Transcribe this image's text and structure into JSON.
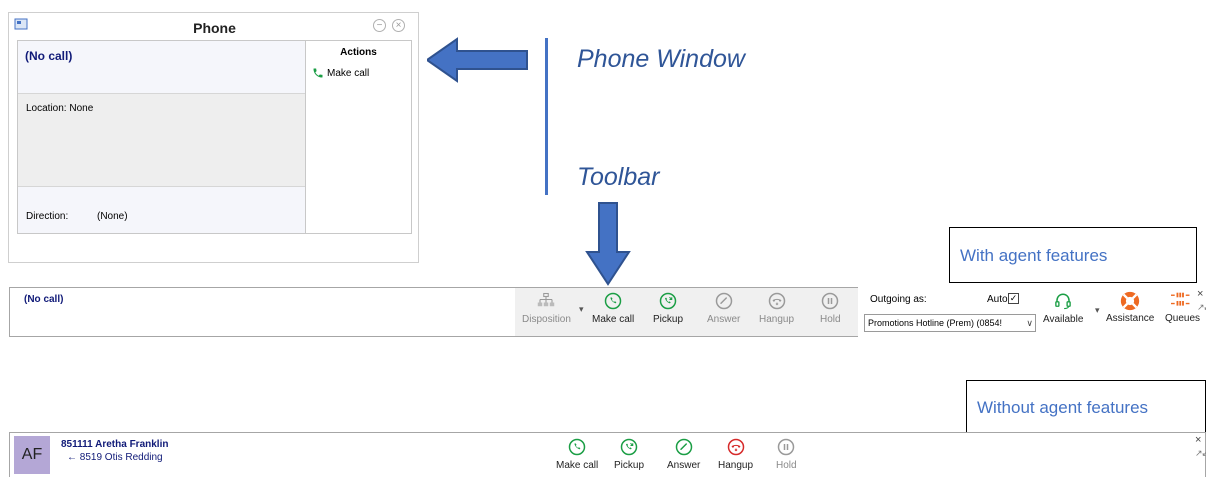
{
  "phone_window": {
    "title": "Phone",
    "status": "(No call)",
    "location": "Location:  None",
    "direction_label": "Direction:",
    "direction_value": "(None)",
    "actions_title": "Actions",
    "actions": [
      {
        "label": "Make call",
        "icon": "phone-icon"
      }
    ]
  },
  "annotations": {
    "phone_window_caption": "Phone Window",
    "toolbar_caption": "Toolbar",
    "with_agent": "With agent features",
    "without_agent": "Without agent features"
  },
  "toolbar_agent": {
    "status": "(No call)",
    "buttons": {
      "disposition": "Disposition",
      "make_call": "Make call",
      "pickup": "Pickup",
      "answer": "Answer",
      "hangup": "Hangup",
      "hold": "Hold",
      "available": "Available",
      "assistance": "Assistance",
      "queues": "Queues"
    },
    "outgoing_label": "Outgoing as:",
    "auto_label": "Auto",
    "auto_checked": true,
    "outgoing_value": "Promotions Hotline (Prem) (0854!"
  },
  "toolbar_plain": {
    "avatar_initials": "AF",
    "caller_primary": "851111  Aretha Franklin",
    "caller_secondary": "← 8519  Otis Redding",
    "buttons": {
      "make_call": "Make call",
      "pickup": "Pickup",
      "answer": "Answer",
      "hangup": "Hangup",
      "hold": "Hold"
    }
  },
  "colors": {
    "accent_blue": "#4472c4",
    "caption_blue": "#2f5597",
    "call_green": "#1b9e45",
    "hangup_red": "#d62a2a",
    "disabled_gray": "#9a9a9a",
    "assist_orange": "#ee6a22",
    "avatar_purple": "#b4a7d6"
  }
}
